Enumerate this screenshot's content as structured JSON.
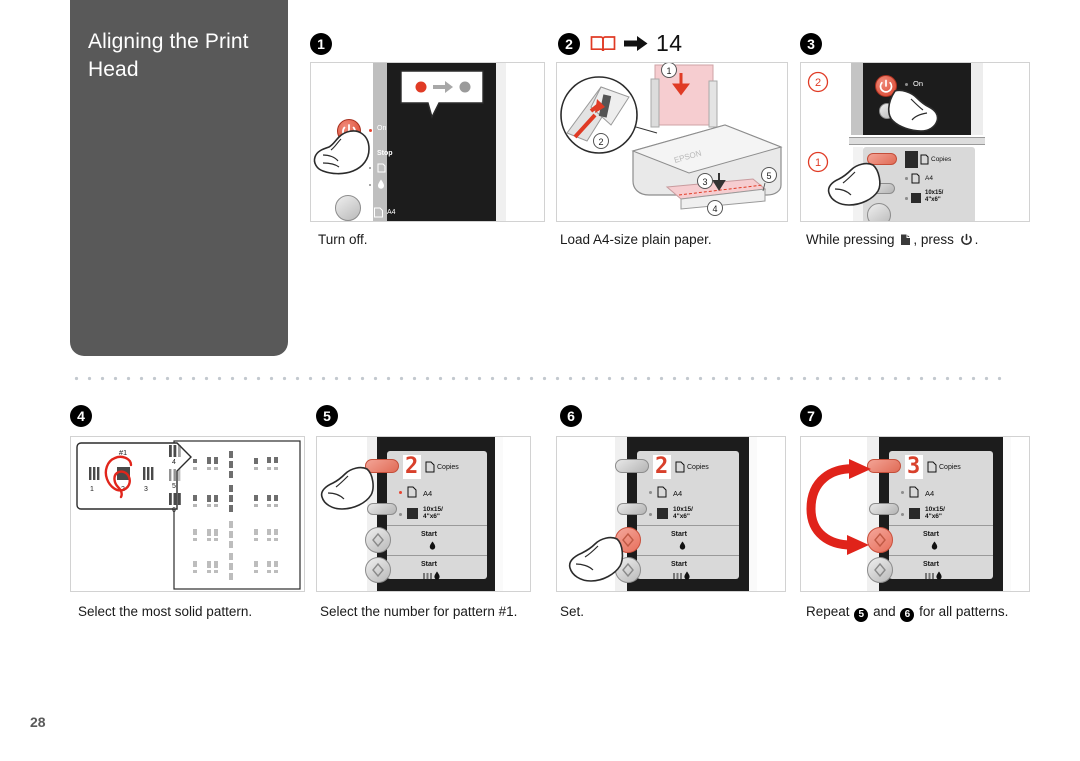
{
  "page": {
    "number": "28",
    "title": "Aligning the Print Head"
  },
  "reference": {
    "book_icon": "book-icon",
    "arrow_icon": "arrow-right-icon",
    "page": "14"
  },
  "steps": [
    {
      "badge": "1",
      "caption": "Turn off.",
      "panel": {
        "name": "panel-turn-off",
        "callout_leds": [
          "on",
          "off"
        ],
        "labels": [
          "On",
          "Stop",
          "A4"
        ]
      }
    },
    {
      "badge": "2",
      "caption": "Load A4-size plain paper.",
      "panel": {
        "name": "panel-load-paper",
        "callouts": [
          "1",
          "2",
          "3",
          "4",
          "5"
        ],
        "brand": "EPSON"
      }
    },
    {
      "badge": "3",
      "caption_prefix": "While pressing",
      "caption_middle": ", press",
      "caption_suffix": ".",
      "icon_paper": "paper-feed-icon",
      "icon_power": "power-icon",
      "panel": {
        "name": "panel-press-combo",
        "callouts": [
          "1",
          "2"
        ],
        "labels": [
          "On",
          "Copies",
          "A4",
          "10x15/\n4\"x6\""
        ]
      }
    },
    {
      "badge": "4",
      "caption": "Select the most solid pattern.",
      "panel": {
        "name": "panel-select-pattern",
        "pattern_label": "#1",
        "pattern_numbers": [
          "1",
          "2",
          "3",
          "4",
          "5",
          "6"
        ],
        "circled": "2"
      }
    },
    {
      "badge": "5",
      "caption": "Select the number for pattern #1.",
      "panel": {
        "name": "panel-select-number",
        "display_value": "2",
        "labels": [
          "Copies",
          "A4",
          "10x15/\n4\"x6\"",
          "Start",
          "Start"
        ]
      }
    },
    {
      "badge": "6",
      "caption": "Set.",
      "panel": {
        "name": "panel-set",
        "display_value": "2",
        "labels": [
          "Copies",
          "A4",
          "10x15/\n4\"x6\"",
          "Start",
          "Start"
        ]
      }
    },
    {
      "badge": "7",
      "caption_prefix": "Repeat",
      "caption_mid": "and",
      "caption_suffix": "for all patterns.",
      "repeat_badges": [
        "5",
        "6"
      ],
      "panel": {
        "name": "panel-repeat",
        "display_value": "3",
        "labels": [
          "Copies",
          "A4",
          "10x15/\n4\"x6\"",
          "Start",
          "Start"
        ]
      }
    }
  ],
  "control_labels": {
    "on": "On",
    "stop": "Stop",
    "copies": "Copies",
    "a4": "A4",
    "photo": "10x15/",
    "photo2": "4\"x6\"",
    "start": "Start"
  },
  "colors": {
    "sidebar": "#595959",
    "accent_red": "#d8402b",
    "badge": "#000000",
    "panel_border": "#d2d2d2",
    "divider": "#c3c9cf"
  }
}
